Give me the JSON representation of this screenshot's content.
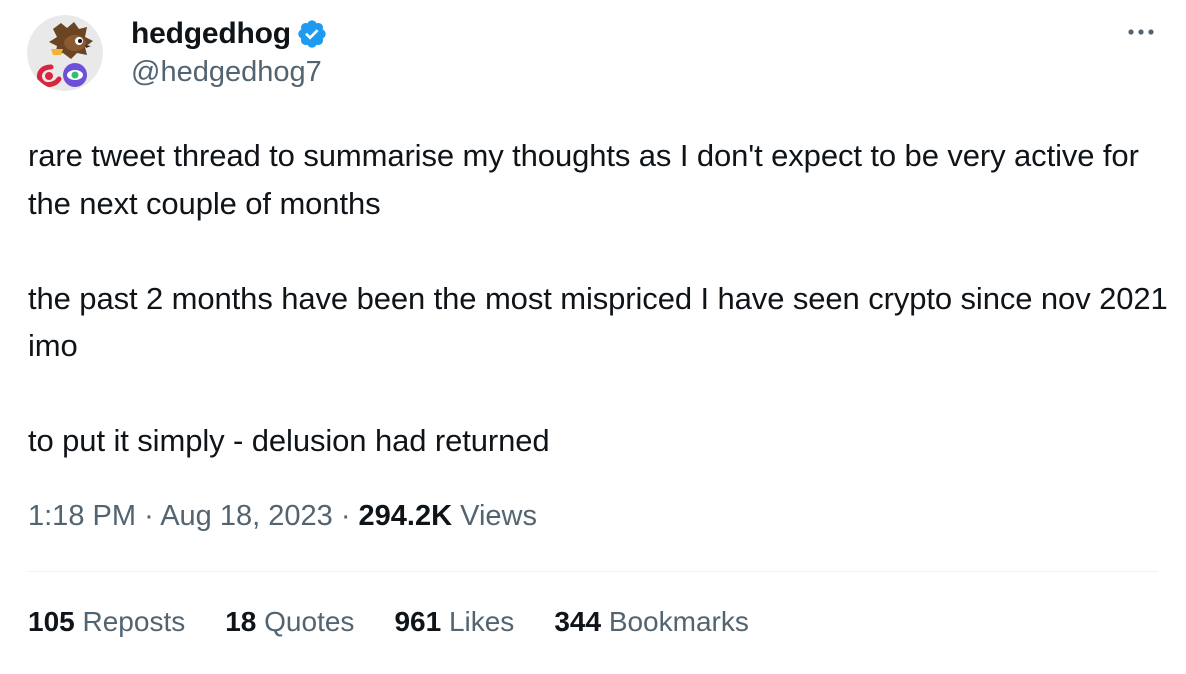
{
  "author": {
    "display_name": "hedgedhog",
    "handle": "@hedgedhog7",
    "verified_color": "#1d9bf0"
  },
  "tweet": {
    "text": "rare tweet thread to summarise my thoughts as I don't expect to be very active for the next couple of months\n\nthe past 2 months have been the most mispriced I have seen crypto since nov 2021 imo\n\nto put it simply - delusion had returned",
    "time": "1:18 PM",
    "separator": "·",
    "date": "Aug 18, 2023",
    "views_count": "294.2K",
    "views_label": "Views"
  },
  "stats": {
    "reposts": {
      "count": "105",
      "label": "Reposts"
    },
    "quotes": {
      "count": "18",
      "label": "Quotes"
    },
    "likes": {
      "count": "961",
      "label": "Likes"
    },
    "bookmarks": {
      "count": "344",
      "label": "Bookmarks"
    }
  },
  "icons": {
    "more": "more-options-icon",
    "verified": "verified-badge-icon"
  },
  "colors": {
    "text": "#0f1419",
    "secondary": "#536471",
    "accent": "#1d9bf0",
    "divider": "#eff3f4"
  }
}
